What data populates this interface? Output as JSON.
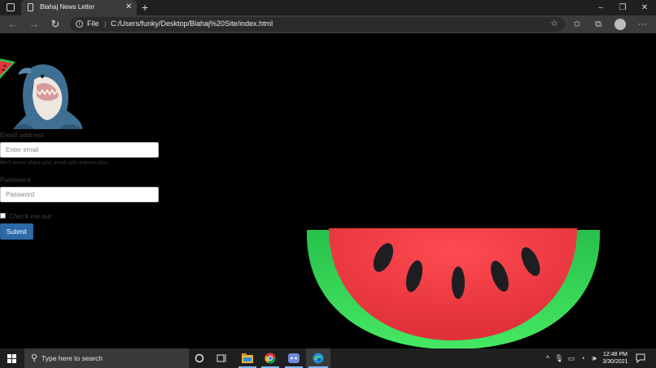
{
  "browser": {
    "tab_title": "Blahaj News Letter",
    "tab_close": "✕",
    "new_tab": "+",
    "window_minimize": "–",
    "window_maximize": "❐",
    "window_close": "✕",
    "back": "←",
    "forward": "→",
    "reload": "↻",
    "scheme_label": "File",
    "separator": "|",
    "url": "C:/Users/funky/Desktop/Blahaj%20Site/index.html",
    "menu": "···"
  },
  "form": {
    "email_label": "Email address",
    "email_placeholder": "Enter email",
    "email_help": "We'll never share your email with anyone else.",
    "password_label": "Password",
    "password_placeholder": "Password",
    "checkbox_label": "Check me out",
    "submit_label": "Submit"
  },
  "taskbar": {
    "search_placeholder": "Type here to search",
    "time": "12:48 PM",
    "date": "3/30/2021"
  },
  "colors": {
    "page_background": "#000000",
    "submit_button": "#2c6aa8",
    "watermelon_rind": "#3ddc5a",
    "watermelon_flesh": "#f23a44"
  },
  "icons": [
    "tab-actions-icon",
    "page-icon",
    "info-icon",
    "favorite-icon",
    "favorites-icon",
    "collections-icon",
    "profile-avatar",
    "windows-start-icon",
    "search-icon",
    "cortana-icon",
    "task-view-icon",
    "file-explorer-icon",
    "chrome-icon",
    "discord-icon",
    "edge-icon",
    "notification-icon"
  ]
}
